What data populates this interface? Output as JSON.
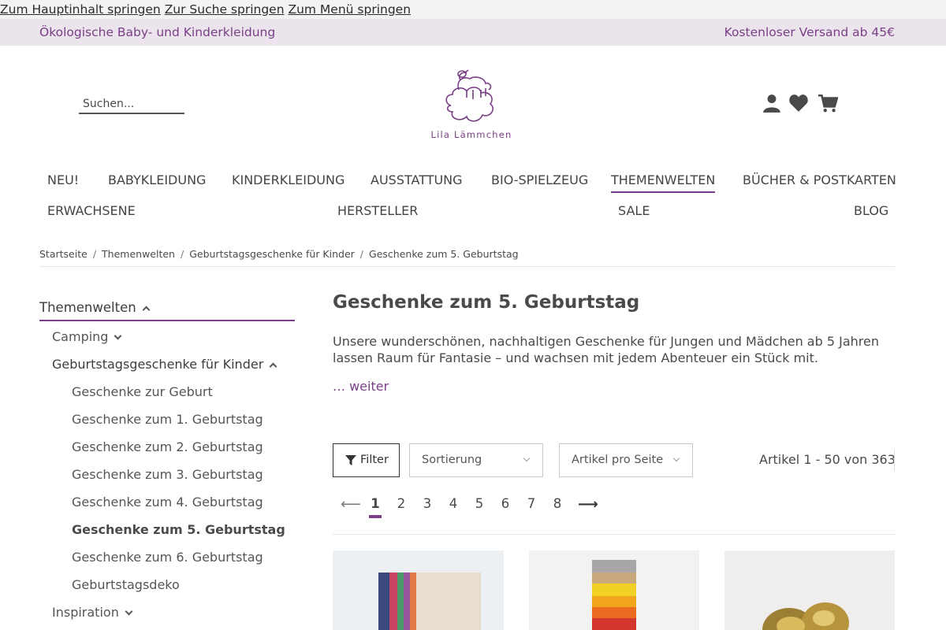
{
  "skip_links": [
    "Zum Hauptinhalt springen",
    "Zur Suche springen",
    "Zum Menü springen"
  ],
  "topbar": {
    "left": "Ökologische Baby- und Kinderkleidung",
    "right": "Kostenloser Versand ab 45€"
  },
  "search": {
    "placeholder": "Suchen..."
  },
  "logo": {
    "text": "Lila Lämmchen"
  },
  "nav": {
    "row1": [
      "NEU!",
      "BABYKLEIDUNG",
      "KINDERKLEIDUNG",
      "AUSSTATTUNG",
      "BIO-SPIELZEUG",
      "THEMENWELTEN",
      "BÜCHER & POSTKARTEN"
    ],
    "row2": [
      "ERWACHSENE",
      "HERSTELLER",
      "SALE",
      "BLOG"
    ]
  },
  "breadcrumb": [
    "Startseite",
    "Themenwelten",
    "Geburtstagsgeschenke für Kinder",
    "Geschenke zum 5. Geburtstag"
  ],
  "sidebar": {
    "title": "Themenwelten",
    "items": [
      {
        "label": "Camping"
      },
      {
        "label": "Geburtstagsgeschenke für Kinder"
      },
      {
        "label": "Geschenke zur Geburt"
      },
      {
        "label": "Geschenke zum 1. Geburtstag"
      },
      {
        "label": "Geschenke zum 2. Geburtstag"
      },
      {
        "label": "Geschenke zum 3. Geburtstag"
      },
      {
        "label": "Geschenke zum 4. Geburtstag"
      },
      {
        "label": "Geschenke zum 5. Geburtstag"
      },
      {
        "label": "Geschenke zum 6. Geburtstag"
      },
      {
        "label": "Geburtstagsdeko"
      },
      {
        "label": "Inspiration"
      }
    ]
  },
  "main": {
    "title": "Geschenke zum 5. Geburtstag",
    "description": "Unsere wunderschönen, nachhaltigen Geschenke für Jungen und Mädchen ab 5 Jahren lassen Raum für Fantasie – und wachsen mit jedem Abenteuer ein Stück mit.",
    "more": "… weiter"
  },
  "toolbar": {
    "filter": "Filter",
    "sort": "Sortierung",
    "per_page": "Artikel pro Seite",
    "count": "Artikel 1 - 50 von 363"
  },
  "pagination": {
    "pages": [
      "1",
      "2",
      "3",
      "4",
      "5",
      "6",
      "7",
      "8"
    ],
    "current": "1"
  },
  "colors": {
    "brand": "#7a3f86",
    "topbar_bg": "#ebe4ec"
  }
}
